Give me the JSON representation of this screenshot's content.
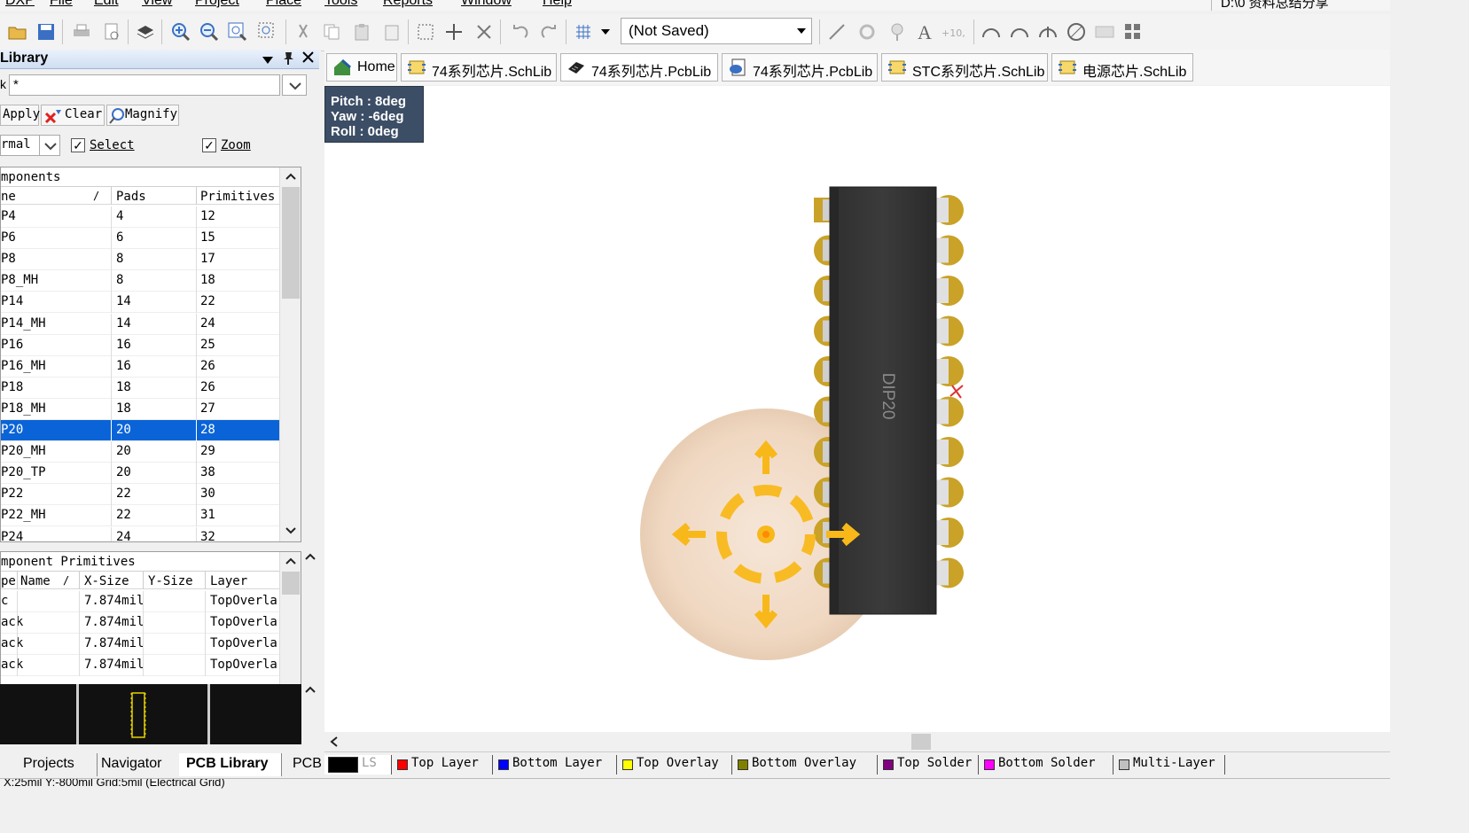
{
  "menubar": {
    "items": [
      "DXP",
      "File",
      "Edit",
      "View",
      "Project",
      "Place",
      "Tools",
      "Reports",
      "Window",
      "Help"
    ],
    "path": "D:\\0 资料总结分享"
  },
  "toolbar": {
    "state_combo": "(Not Saved)"
  },
  "library_panel": {
    "title": "Library",
    "mask_label": "k",
    "mask_value": "*",
    "apply_label": "Apply",
    "clear_label": "Clear",
    "magnify_label": "Magnify",
    "mode_value": "rmal",
    "select_label": "Select",
    "zoom_label": "Zoom",
    "components_title": "mponents",
    "columns": [
      "ne",
      "Pads",
      "Primitives"
    ],
    "rows": [
      {
        "name": "P4",
        "pads": "4",
        "prims": "12"
      },
      {
        "name": "P6",
        "pads": "6",
        "prims": "15"
      },
      {
        "name": "P8",
        "pads": "8",
        "prims": "17"
      },
      {
        "name": "P8_MH",
        "pads": "8",
        "prims": "18"
      },
      {
        "name": "P14",
        "pads": "14",
        "prims": "22"
      },
      {
        "name": "P14_MH",
        "pads": "14",
        "prims": "24"
      },
      {
        "name": "P16",
        "pads": "16",
        "prims": "25"
      },
      {
        "name": "P16_MH",
        "pads": "16",
        "prims": "26"
      },
      {
        "name": "P18",
        "pads": "18",
        "prims": "26"
      },
      {
        "name": "P18_MH",
        "pads": "18",
        "prims": "27"
      },
      {
        "name": "P20",
        "pads": "20",
        "prims": "28"
      },
      {
        "name": "P20_MH",
        "pads": "20",
        "prims": "29"
      },
      {
        "name": "P20_TP",
        "pads": "20",
        "prims": "38"
      },
      {
        "name": "P22",
        "pads": "22",
        "prims": "30"
      },
      {
        "name": "P22_MH",
        "pads": "22",
        "prims": "31"
      },
      {
        "name": "P24",
        "pads": "24",
        "prims": "32"
      }
    ],
    "primitives_title": "mponent Primitives",
    "prim_columns": [
      "pe",
      "Name",
      "X-Size",
      "Y-Size",
      "Layer"
    ],
    "prim_rows": [
      {
        "type": "c",
        "name": "",
        "x": "7.874mil",
        "y": "",
        "layer": "TopOverla"
      },
      {
        "type": "ack",
        "name": "",
        "x": "7.874mil",
        "y": "",
        "layer": "TopOverla"
      },
      {
        "type": "ack",
        "name": "",
        "x": "7.874mil",
        "y": "",
        "layer": "TopOverla"
      },
      {
        "type": "ack",
        "name": "",
        "x": "7.874mil",
        "y": "",
        "layer": "TopOverla"
      }
    ]
  },
  "panel_tabs": [
    "Projects",
    "Navigator",
    "PCB Library",
    "PCB"
  ],
  "doc_tabs": [
    {
      "label": "Home",
      "icon": "home-icon"
    },
    {
      "label": "74系列芯片.SchLib",
      "icon": "schlib-icon"
    },
    {
      "label": "74系列芯片.PcbLib",
      "icon": "pcblib-icon"
    },
    {
      "label": "74系列芯片.PcbLib",
      "icon": "pcblib-doc-icon"
    },
    {
      "label": "STC系列芯片.SchLib",
      "icon": "schlib-icon"
    },
    {
      "label": "电源芯片.SchLib",
      "icon": "schlib-icon"
    }
  ],
  "hud": {
    "pitch": "Pitch : 8deg",
    "yaw": "Yaw : -6deg",
    "roll": "Roll : 0deg"
  },
  "component": {
    "label": "DIP20",
    "body_color": "#3a3a3a",
    "pad_color": "#c9a227",
    "pin_count": 20
  },
  "layer_tabs": [
    {
      "label": "LS",
      "color": "#000000"
    },
    {
      "label": "Top Layer",
      "color": "#ff0000"
    },
    {
      "label": "Bottom Layer",
      "color": "#0000ff"
    },
    {
      "label": "Top Overlay",
      "color": "#ffff00"
    },
    {
      "label": "Bottom Overlay",
      "color": "#808000"
    },
    {
      "label": "Top Solder",
      "color": "#800080"
    },
    {
      "label": "Bottom Solder",
      "color": "#ff00ff"
    },
    {
      "label": "Multi-Layer",
      "color": "#c0c0c0"
    }
  ],
  "status_text": "X:25mil Y:-800mil  Grid:5mil  (Electrical Grid)"
}
